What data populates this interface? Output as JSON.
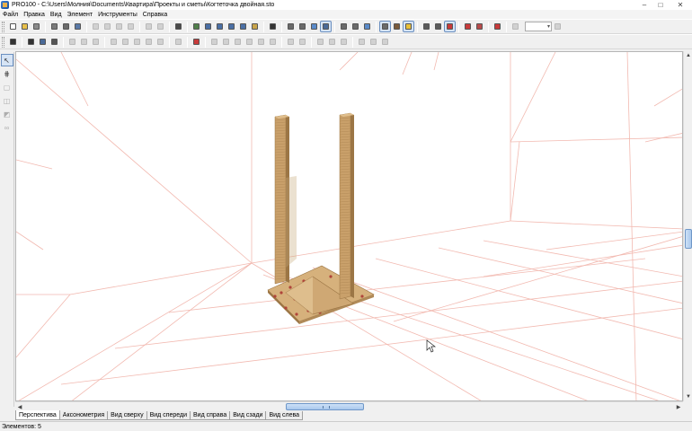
{
  "window": {
    "title": "PRO100 - C:\\Users\\Молния\\Documents\\Квартира\\Проекты и сметы\\Когтеточка двойная.sto",
    "minimize": "–",
    "maximize": "□",
    "close": "✕"
  },
  "menu": [
    "Файл",
    "Правка",
    "Вид",
    "Элемент",
    "Инструменты",
    "Справка"
  ],
  "toolbar1": [
    {
      "name": "new-icon",
      "color": "#ffffff",
      "state": "normal"
    },
    {
      "name": "open-icon",
      "color": "#e8c04a",
      "state": "normal"
    },
    {
      "name": "save-icon",
      "color": "#8a8a8a",
      "state": "normal"
    },
    {
      "sep": true
    },
    {
      "name": "preview-icon",
      "color": "#7a7a7a",
      "state": "normal"
    },
    {
      "name": "print-icon",
      "color": "#6a6a6a",
      "state": "normal"
    },
    {
      "name": "print-preview-icon",
      "color": "#5a7aa8",
      "state": "normal"
    },
    {
      "sep": true
    },
    {
      "name": "cut-icon",
      "color": "#9a9a9a",
      "state": "disabled"
    },
    {
      "name": "copy-icon",
      "color": "#9a9a9a",
      "state": "disabled"
    },
    {
      "name": "paste-icon",
      "color": "#9a9a9a",
      "state": "disabled"
    },
    {
      "name": "delete-icon",
      "color": "#9a9a9a",
      "state": "disabled"
    },
    {
      "sep": true
    },
    {
      "name": "undo-icon",
      "color": "#9a9a9a",
      "state": "disabled"
    },
    {
      "name": "redo-icon",
      "color": "#9a9a9a",
      "state": "disabled"
    },
    {
      "sep": true
    },
    {
      "name": "view-frame-icon",
      "color": "#4a4a4a",
      "state": "normal"
    },
    {
      "sep": true
    },
    {
      "name": "library-icon",
      "color": "#4f7f4a",
      "state": "normal"
    },
    {
      "name": "library-open-icon",
      "color": "#4a6fa5",
      "state": "normal"
    },
    {
      "name": "library-save-icon",
      "color": "#4a6fa5",
      "state": "normal"
    },
    {
      "name": "library-edit-icon",
      "color": "#4a6fa5",
      "state": "normal"
    },
    {
      "name": "library-add-icon",
      "color": "#4a6fa5",
      "state": "normal"
    },
    {
      "name": "library-props-icon",
      "color": "#c8a44a",
      "state": "normal"
    },
    {
      "sep": true
    },
    {
      "name": "sum-icon",
      "color": "#333333",
      "state": "normal"
    },
    {
      "sep": true
    },
    {
      "name": "view-wire-icon",
      "color": "#6a6a6a",
      "state": "normal"
    },
    {
      "name": "view-hidden-icon",
      "color": "#6a6a6a",
      "state": "normal"
    },
    {
      "name": "view-solid-icon",
      "color": "#5a8ac8",
      "state": "normal"
    },
    {
      "name": "view-render-icon",
      "color": "#4a6a98",
      "state": "active"
    },
    {
      "sep": true
    },
    {
      "name": "cube-outline-icon",
      "color": "#6a6a6a",
      "state": "normal"
    },
    {
      "name": "cube-lines-icon",
      "color": "#6a6a6a",
      "state": "normal"
    },
    {
      "name": "cube-shaded-icon",
      "color": "#5a8ac8",
      "state": "normal"
    },
    {
      "sep": true
    },
    {
      "name": "hand-icon",
      "color": "#6a6a6a",
      "state": "active"
    },
    {
      "name": "brush-icon",
      "color": "#7a5a3a",
      "state": "normal"
    },
    {
      "name": "light-icon",
      "color": "#e8c03a",
      "state": "active"
    },
    {
      "sep": true
    },
    {
      "name": "dimension-icon",
      "color": "#5a5a5a",
      "state": "normal"
    },
    {
      "name": "measure-icon",
      "color": "#5a5a5a",
      "state": "normal"
    },
    {
      "name": "grid-icon",
      "color": "#c83a3a",
      "state": "active"
    },
    {
      "sep": true
    },
    {
      "name": "magnet-icon",
      "color": "#c83a3a",
      "state": "normal"
    },
    {
      "name": "snap-icon",
      "color": "#b84a4a",
      "state": "normal"
    },
    {
      "sep": true
    },
    {
      "name": "target-icon",
      "color": "#c83a3a",
      "state": "normal"
    },
    {
      "sep": true
    },
    {
      "name": "zoom-icon",
      "color": "#9a9a9a",
      "state": "disabled"
    },
    {
      "zoom": true
    },
    {
      "name": "zoom-fit-icon",
      "color": "#9a9a9a",
      "state": "disabled"
    }
  ],
  "toolbar2": [
    {
      "name": "grid-points-icon",
      "color": "#333333",
      "state": "normal"
    },
    {
      "sep": true
    },
    {
      "name": "move-icon",
      "color": "#333333",
      "state": "normal"
    },
    {
      "name": "rotate-icon",
      "color": "#4a6a98",
      "state": "normal"
    },
    {
      "name": "pen-icon",
      "color": "#555555",
      "state": "normal"
    },
    {
      "sep": true
    },
    {
      "name": "frame-icon",
      "color": "#9a9a9a",
      "state": "disabled"
    },
    {
      "name": "frame-select-icon",
      "color": "#9a9a9a",
      "state": "disabled"
    },
    {
      "name": "group-icon",
      "color": "#9a9a9a",
      "state": "disabled"
    },
    {
      "sep": true
    },
    {
      "name": "arrow-down-icon",
      "color": "#9a9a9a",
      "state": "disabled"
    },
    {
      "name": "arrow-left-icon",
      "color": "#9a9a9a",
      "state": "disabled"
    },
    {
      "name": "arrow-right-icon",
      "color": "#9a9a9a",
      "state": "disabled"
    },
    {
      "name": "plus-icon",
      "color": "#9a9a9a",
      "state": "disabled"
    },
    {
      "name": "arrow-up-icon",
      "color": "#9a9a9a",
      "state": "disabled"
    },
    {
      "sep": true
    },
    {
      "name": "list-icon",
      "color": "#9a9a9a",
      "state": "disabled"
    },
    {
      "sep": true
    },
    {
      "name": "stop-icon",
      "color": "#c83a3a",
      "state": "normal"
    },
    {
      "sep": true
    },
    {
      "name": "align-left-icon",
      "color": "#9a9a9a",
      "state": "disabled"
    },
    {
      "name": "align-center-icon",
      "color": "#9a9a9a",
      "state": "disabled"
    },
    {
      "name": "align-right-icon",
      "color": "#9a9a9a",
      "state": "disabled"
    },
    {
      "name": "align-top-icon",
      "color": "#9a9a9a",
      "state": "disabled"
    },
    {
      "name": "align-middle-icon",
      "color": "#9a9a9a",
      "state": "disabled"
    },
    {
      "name": "align-bottom-icon",
      "color": "#9a9a9a",
      "state": "disabled"
    },
    {
      "sep": true
    },
    {
      "name": "distribute-h-icon",
      "color": "#9a9a9a",
      "state": "disabled"
    },
    {
      "name": "distribute-v-icon",
      "color": "#9a9a9a",
      "state": "disabled"
    },
    {
      "sep": true
    },
    {
      "name": "same-width-icon",
      "color": "#9a9a9a",
      "state": "disabled"
    },
    {
      "name": "same-height-icon",
      "color": "#9a9a9a",
      "state": "disabled"
    },
    {
      "name": "same-depth-icon",
      "color": "#9a9a9a",
      "state": "disabled"
    },
    {
      "sep": true
    },
    {
      "name": "flip-icon",
      "color": "#9a9a9a",
      "state": "disabled"
    },
    {
      "name": "mirror-icon",
      "color": "#9a9a9a",
      "state": "disabled"
    },
    {
      "name": "array-icon",
      "color": "#9a9a9a",
      "state": "disabled"
    }
  ],
  "left_tools": [
    {
      "name": "select-arrow-icon",
      "glyph": "↖",
      "state": "active"
    },
    {
      "name": "hatch-icon",
      "glyph": "⋕",
      "state": "normal"
    },
    {
      "name": "box-tool-icon",
      "glyph": "▢",
      "state": "disabled"
    },
    {
      "name": "panel-tool-icon",
      "glyph": "◫",
      "state": "disabled"
    },
    {
      "name": "edge-tool-icon",
      "glyph": "◩",
      "state": "disabled"
    },
    {
      "name": "link-tool-icon",
      "glyph": "∞",
      "state": "disabled"
    }
  ],
  "tabs": [
    {
      "label": "Перспектива",
      "active": true
    },
    {
      "label": "Аксонометрия",
      "active": false
    },
    {
      "label": "Вид сверху",
      "active": false
    },
    {
      "label": "Вид спереди",
      "active": false
    },
    {
      "label": "Вид справа",
      "active": false
    },
    {
      "label": "Вид сзади",
      "active": false
    },
    {
      "label": "Вид слева",
      "active": false
    }
  ],
  "status": {
    "text": "Элементов: 5"
  },
  "colors": {
    "grid_line": "#f2b9b0",
    "post": "#c9a06a",
    "post_dark": "#9c7645",
    "base": "#d6b17c",
    "base_pattern": "#b0453a"
  }
}
